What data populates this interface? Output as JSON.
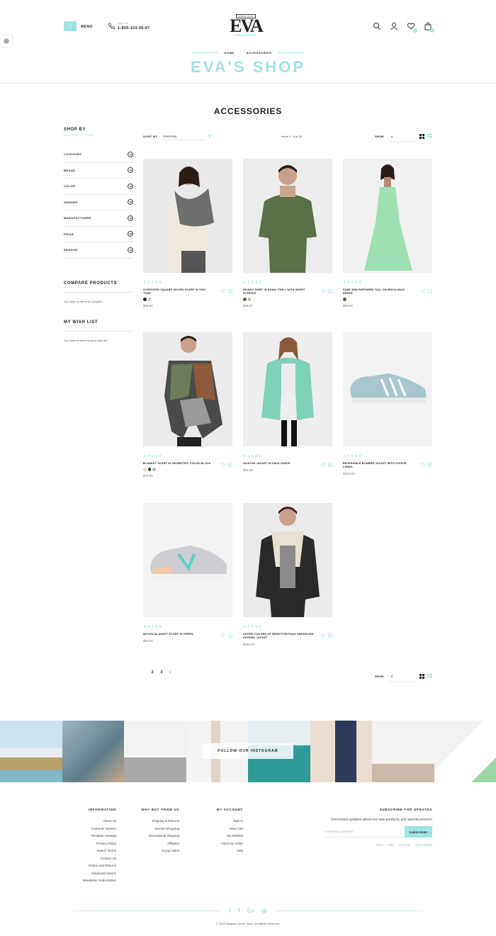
{
  "header": {
    "menu_label": "MENU",
    "menu_box_label": "≡",
    "phone_sub": "CALL US",
    "phone": "1-800-123-45-07",
    "logo_since": "SINCE 2018",
    "logo_text": "EVA",
    "cart_count": "0",
    "wish_count": "0"
  },
  "breadcrumb": {
    "home": "HOME",
    "sep": "/",
    "current": "ACCESSORIES"
  },
  "shop_title": "EVA'S SHOP",
  "page_title": "ACCESSORIES",
  "sidebar": {
    "shop_by": "SHOP BY",
    "shopping_options": "SHOPPING OPTIONS",
    "filters": [
      "CATEGORY",
      "BRAND",
      "COLOR",
      "GENDER",
      "MANUFACTURER",
      "PRICE",
      "SEASON"
    ],
    "compare_title": "COMPARE PRODUCTS",
    "compare_text": "You have no items to compare.",
    "wishlist_title": "MY WISH LIST",
    "wishlist_text": "You have no items in your wish list."
  },
  "toolbar": {
    "sort_by": "SORT BY",
    "sort_value": "POSITION",
    "count": "Items 1 - 8 of 18",
    "show": "SHOW",
    "limit": "8"
  },
  "products": [
    {
      "name": "OVERSIZED SQUARE WOVEN SCARF IN TWO TONE",
      "price": "$88.00",
      "swatches": [
        "#222222",
        "#cccccc"
      ]
    },
    {
      "name": "SKINNY SHIRT IN KHAKI TWILL WITH SHORT SLEEVES",
      "price": "$65.00",
      "swatches": [
        "#3f6b3a",
        "#bbbbbb"
      ]
    },
    {
      "name": "FAME AND PARTNERS TALL VALENCIA MAXI DRESS",
      "price": "$65.00",
      "swatches": [
        "#3f6b3a"
      ]
    },
    {
      "name": "BLANKET SCARF IN GEOMETRIC COLOR BLOCK",
      "price": "$78.00",
      "swatches": [
        "#e6d3a8",
        "#2f5a2f",
        "#bbbbbb"
      ]
    },
    {
      "name": "AVIATOR JACKET IN FAUX SUEDE",
      "price": "$84.00",
      "swatches": []
    },
    {
      "name": "REVERSIBLE BOMBER JACKET WITH FLEECE LINING",
      "price": "$154.00",
      "swatches": []
    },
    {
      "name": "WOVEN BLANKET SCARF IN GREEN",
      "price": "$59.00",
      "swatches": []
    },
    {
      "name": "UNITED COLORS OF BENETTON FAUX SHEARLING HOODED JACKET",
      "price": "$234.00",
      "swatches": []
    }
  ],
  "stars": "★★★★★",
  "pagination": {
    "prev": "‹",
    "pages": [
      "2",
      "3"
    ],
    "next": "›"
  },
  "instagram_button": "FOLLOW OUR INSTAGRAM",
  "footer": {
    "information": {
      "title": "INFORMATION",
      "links": [
        "About Us",
        "Customer Service",
        "Template Settings",
        "Privacy Policy",
        "Search Terms",
        "Contact Us",
        "Orders and Returns",
        "Advanced Search",
        "Newsletter Subscription"
      ]
    },
    "why_buy": {
      "title": "WHY BUY FROM US",
      "links": [
        "Shipping & Returns",
        "Secure Shopping",
        "International Shipping",
        "Affiliates",
        "Group Sales"
      ]
    },
    "account": {
      "title": "MY ACCOUNT",
      "links": [
        "Sign In",
        "View Cart",
        "My Wishlist",
        "Track My Order",
        "Help"
      ]
    },
    "subscribe": {
      "title": "SUBSCRIBE FOR UPDATES",
      "text": "Get instant updates about our new products and special promos!",
      "placeholder": "YOUR EMAIL ADDRESS",
      "button": "SUBSCRIBE",
      "payments": [
        "VISA",
        "MC",
        "PayPal",
        "DISCOVER"
      ]
    },
    "social": [
      "t",
      "f",
      "G+",
      "◎"
    ],
    "copyright": "© 2018 Magento Demo Store. All Rights Reserved."
  },
  "colors": {
    "accent": "#9fe3e3"
  }
}
